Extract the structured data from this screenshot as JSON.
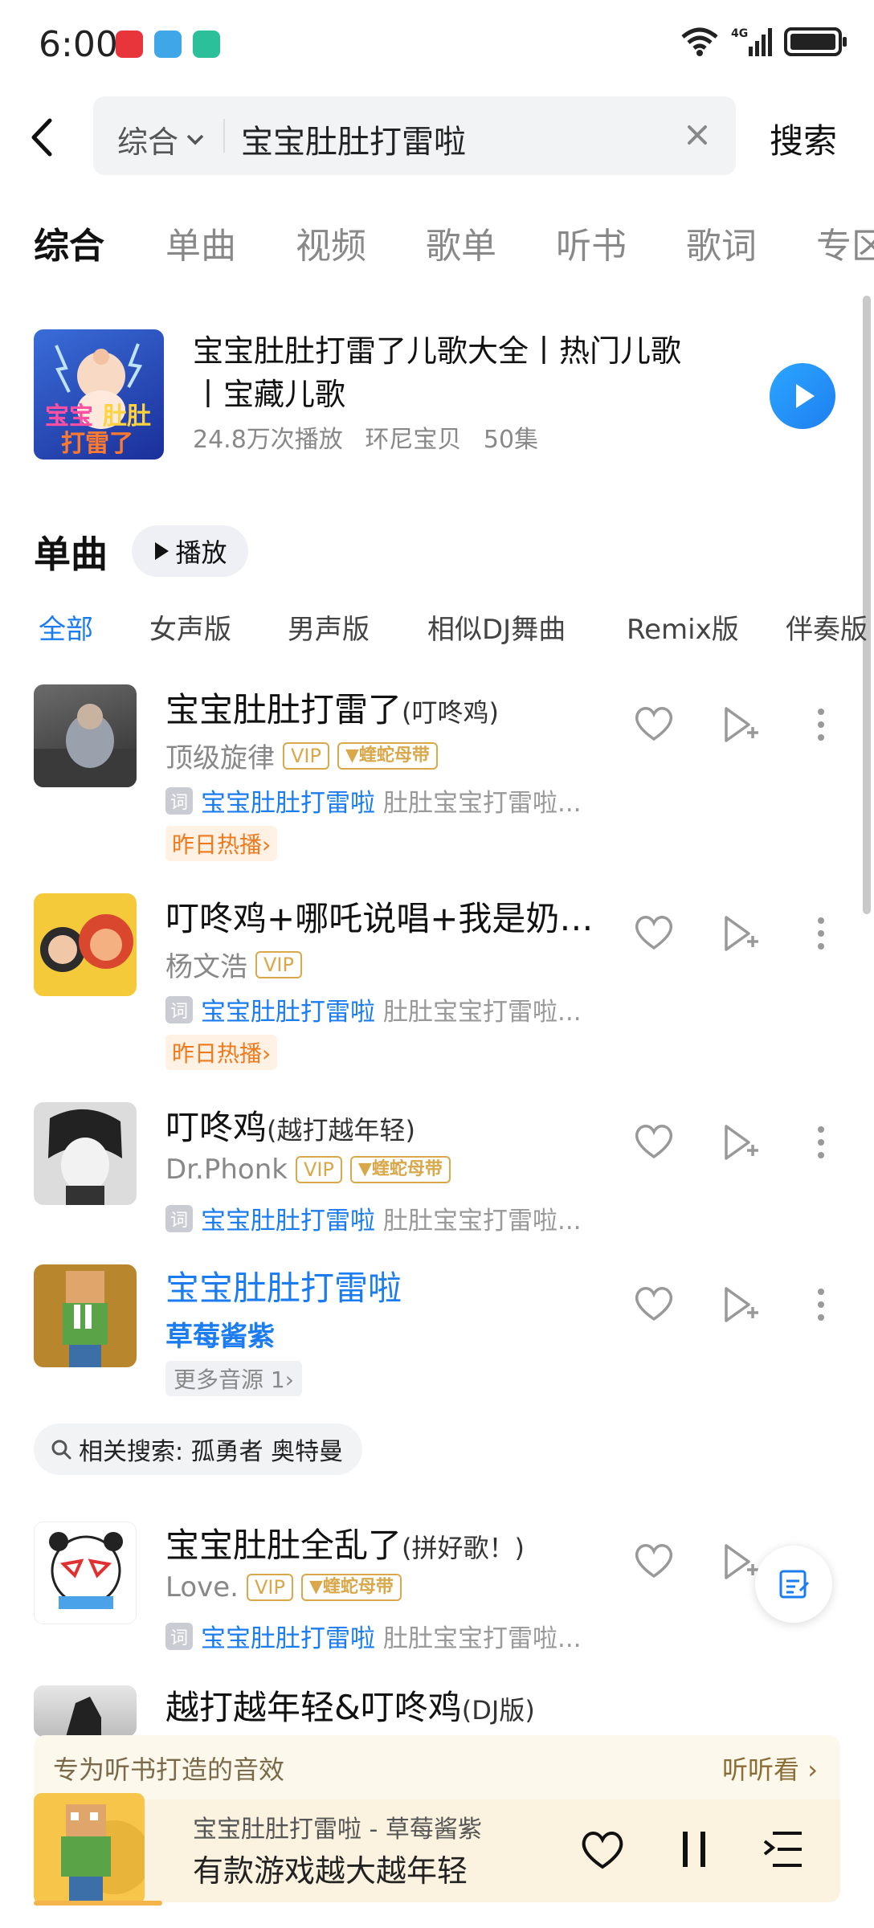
{
  "status_bar": {
    "time": "6:00",
    "network": "4G"
  },
  "search": {
    "scope": "综合",
    "query": "宝宝肚肚打雷啦",
    "button": "搜索"
  },
  "tabs": [
    "综合",
    "单曲",
    "视频",
    "歌单",
    "听书",
    "歌词",
    "专区"
  ],
  "album": {
    "title": "宝宝肚肚打雷了儿歌大全丨热门儿歌丨宝藏儿歌",
    "plays": "24.8万次播放",
    "author": "环尼宝贝",
    "episodes": "50集"
  },
  "singles": {
    "title": "单曲",
    "play_all": "播放",
    "filters": [
      "全部",
      "女声版",
      "男声版",
      "相似DJ舞曲",
      "Remix版",
      "伴奏版"
    ]
  },
  "songs": [
    {
      "title": "宝宝肚肚打雷了",
      "subtitle": "(叮咚鸡)",
      "artist": "顶级旋律",
      "vip": "VIP",
      "badge": "蝰蛇母带",
      "lyric_tag": "词",
      "lyric_highlight": "宝宝肚肚打雷啦",
      "lyric_rest": "肚肚宝宝打雷啦...",
      "hot": "昨日热播"
    },
    {
      "title": "叮咚鸡+哪吒说唱+我是奶龙...",
      "subtitle": "",
      "artist": "杨文浩",
      "vip": "VIP",
      "lyric_tag": "词",
      "lyric_highlight": "宝宝肚肚打雷啦",
      "lyric_rest": "肚肚宝宝打雷啦...",
      "hot": "昨日热播"
    },
    {
      "title": "叮咚鸡",
      "subtitle": "(越打越年轻)",
      "artist": "Dr.Phonk",
      "vip": "VIP",
      "badge": "蝰蛇母带",
      "lyric_tag": "词",
      "lyric_highlight": "宝宝肚肚打雷啦",
      "lyric_rest": "肚肚宝宝打雷啦..."
    },
    {
      "title": "宝宝肚肚打雷啦",
      "artist": "草莓酱紫",
      "more_sources": "更多音源 1"
    },
    {
      "title": "宝宝肚肚全乱了",
      "subtitle": "(拼好歌！)",
      "artist": "Love.",
      "vip": "VIP",
      "badge": "蝰蛇母带",
      "lyric_tag": "词",
      "lyric_highlight": "宝宝肚肚打雷啦",
      "lyric_rest": "肚肚宝宝打雷啦..."
    },
    {
      "title": "越打越年轻&叮咚鸡",
      "subtitle": "(DJ版)"
    }
  ],
  "related_search": "相关搜索: 孤勇者 奥特曼",
  "banner": {
    "text": "专为听书打造的音效",
    "link": "听听看"
  },
  "player": {
    "track": "宝宝肚肚打雷啦 - 草莓酱紫",
    "lyric": "有款游戏越大越年轻"
  },
  "colors": {
    "accent": "#1a7cf0",
    "vip": "#d9a84a",
    "hot": "#ef7a1d"
  }
}
